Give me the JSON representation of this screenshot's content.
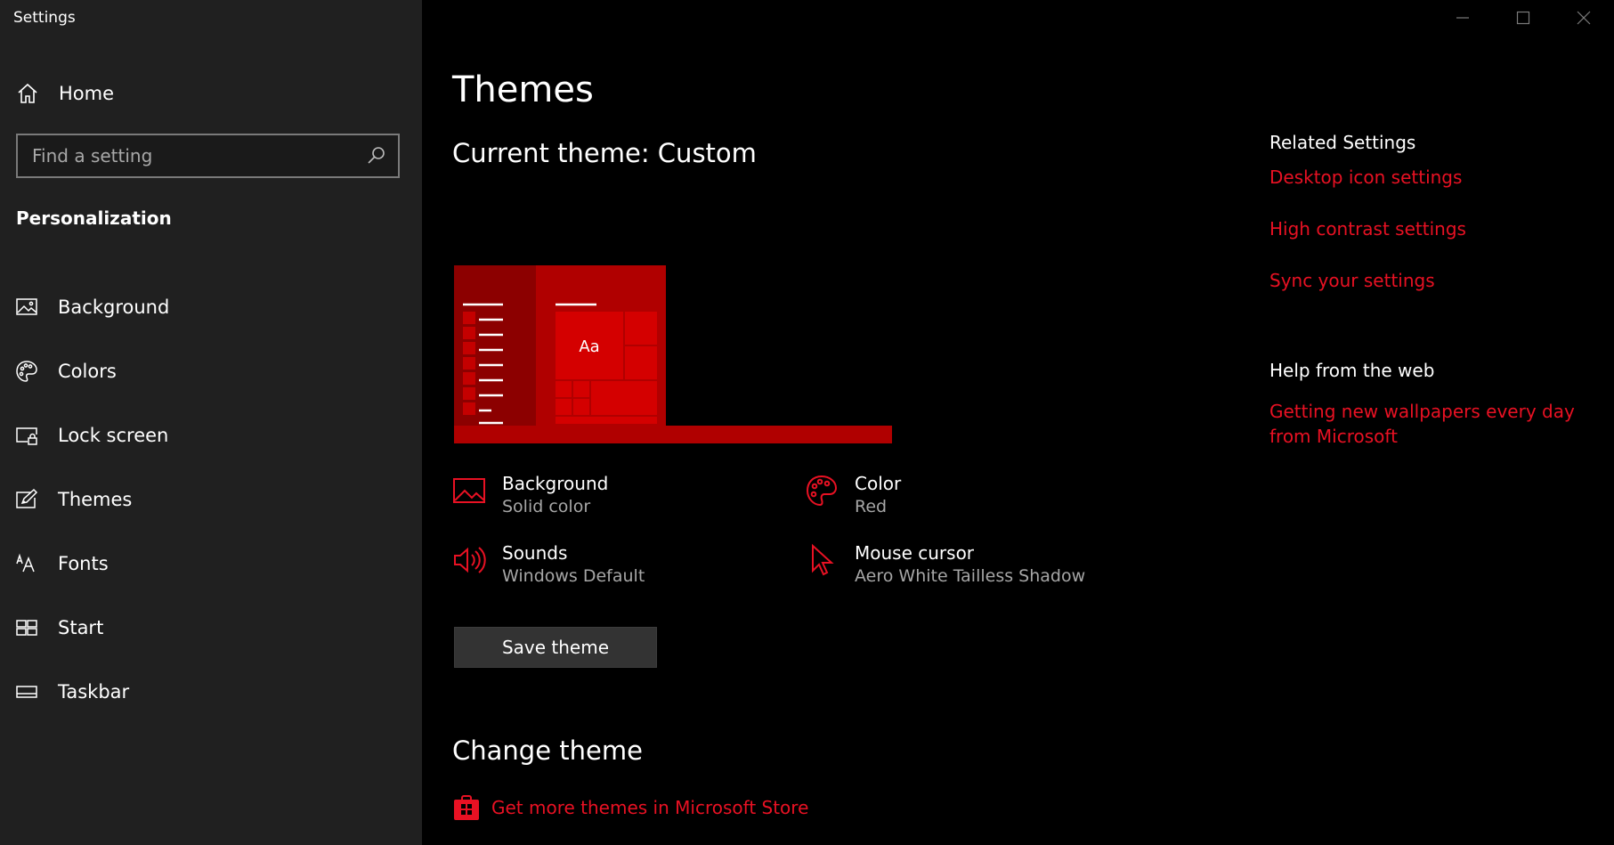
{
  "window": {
    "title": "Settings"
  },
  "sidebar": {
    "home_label": "Home",
    "search_placeholder": "Find a setting",
    "section_title": "Personalization",
    "items": [
      {
        "label": "Background",
        "icon": "image-icon"
      },
      {
        "label": "Colors",
        "icon": "palette-icon"
      },
      {
        "label": "Lock screen",
        "icon": "lock-screen-icon"
      },
      {
        "label": "Themes",
        "icon": "themes-icon"
      },
      {
        "label": "Fonts",
        "icon": "fonts-icon"
      },
      {
        "label": "Start",
        "icon": "start-icon"
      },
      {
        "label": "Taskbar",
        "icon": "taskbar-icon"
      }
    ]
  },
  "main": {
    "title": "Themes",
    "current_theme": "Current theme: Custom",
    "preview": {
      "sample_text": "Aa"
    },
    "properties": {
      "background": {
        "label": "Background",
        "value": "Solid color"
      },
      "color": {
        "label": "Color",
        "value": "Red"
      },
      "sounds": {
        "label": "Sounds",
        "value": "Windows Default"
      },
      "mouse_cursor": {
        "label": "Mouse cursor",
        "value": "Aero White Tailless Shadow"
      }
    },
    "save_button": "Save theme",
    "change_theme_title": "Change theme",
    "store_link": "Get more themes in Microsoft Store"
  },
  "related": {
    "title": "Related Settings",
    "links": [
      "Desktop icon settings",
      "High contrast settings",
      "Sync your settings"
    ]
  },
  "help": {
    "title": "Help from the web",
    "link": "Getting new wallpapers every day from Microsoft"
  },
  "colors": {
    "accent": "#e81123",
    "preview_bg": "#b00000",
    "preview_dark": "#8c0000",
    "sidebar_bg": "#202020",
    "main_bg": "#000000"
  }
}
